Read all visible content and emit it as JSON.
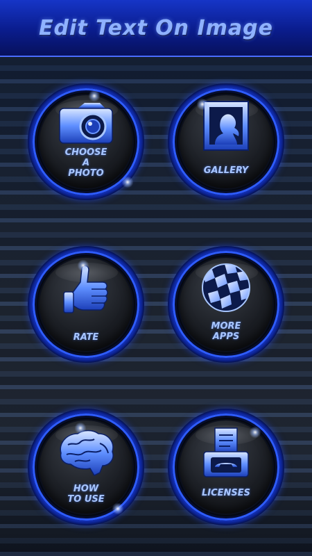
{
  "header": {
    "title": "Edit Text On Image"
  },
  "menu": {
    "choose_photo": {
      "label": "CHOOSE\nA\nPHOTO",
      "icon": "camera-icon"
    },
    "gallery": {
      "label": "GALLERY",
      "icon": "portrait-frame-icon"
    },
    "rate": {
      "label": "RATE",
      "icon": "thumbs-up-icon"
    },
    "more_apps": {
      "label": "MORE\nAPPS",
      "icon": "checkered-globe-icon"
    },
    "how_to_use": {
      "label": "HOW\nTO USE",
      "icon": "brain-icon"
    },
    "licenses": {
      "label": "LICENSES",
      "icon": "fax-phone-icon"
    }
  },
  "colors": {
    "accent": "#2e5cff",
    "label": "#a8c6ff",
    "header": "#1635c7"
  }
}
